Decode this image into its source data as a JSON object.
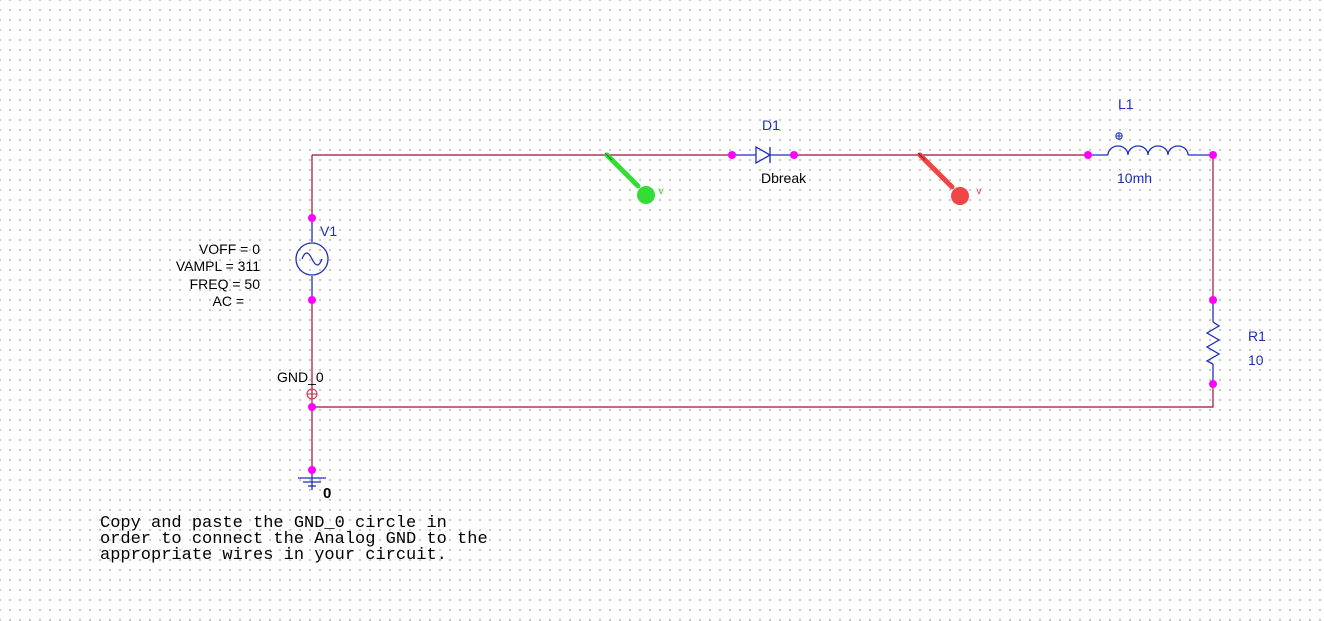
{
  "colors": {
    "wire": "#9a0f3c",
    "component": "#1c2fb8",
    "pin": "#ff00ff",
    "probe_green": "#33dd33",
    "probe_red": "#f04545",
    "grid_dot": "#b9b9b9"
  },
  "source": {
    "ref": "V1",
    "params": [
      "VOFF = 0",
      "VAMPL = 311",
      "FREQ = 50",
      "AC ="
    ]
  },
  "diode": {
    "ref": "D1",
    "model": "Dbreak"
  },
  "inductor": {
    "ref": "L1",
    "value": "10mh"
  },
  "resistor": {
    "ref": "R1",
    "value": "10"
  },
  "offpage": {
    "label": "GND_0"
  },
  "ground": {
    "label": "0"
  },
  "probes": [
    {
      "color": "green",
      "letter": "v"
    },
    {
      "color": "red",
      "letter": "v"
    }
  ],
  "note": {
    "lines": [
      "Copy and paste the GND_0 circle in",
      "order to connect the Analog GND to the",
      "appropriate wires in your circuit."
    ]
  }
}
